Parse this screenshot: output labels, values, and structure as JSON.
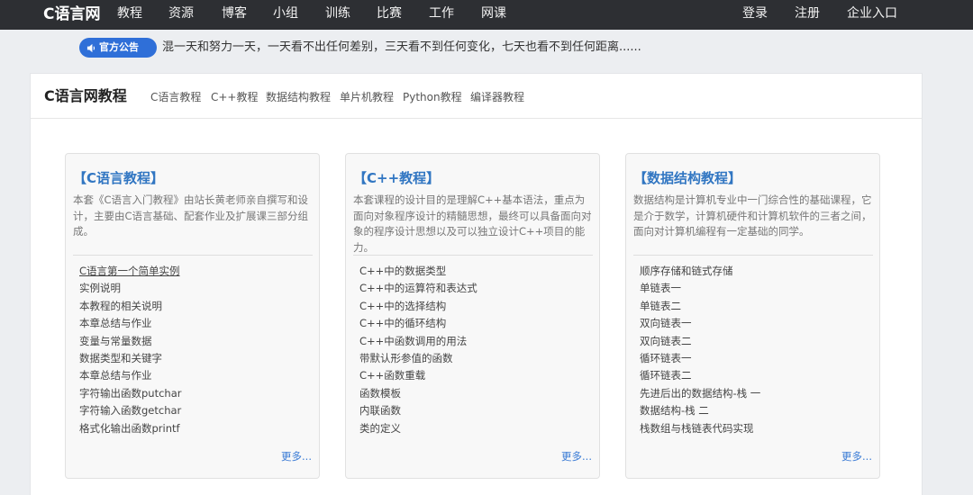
{
  "topnav": {
    "logo": "C语言网",
    "left_items": [
      "教程",
      "资源",
      "博客",
      "小组",
      "训练",
      "比赛",
      "工作",
      "网课"
    ],
    "right_items": [
      "登录",
      "注册",
      "企业入口"
    ],
    "bg_color": "#2d2f33"
  },
  "notice": {
    "badge": "官方公告",
    "text": "混一天和努力一天，一天看不出任何差别，三天看不到任何变化，七天也看不到任何距离......",
    "badge_color": "#2f6fd8"
  },
  "panel": {
    "title": "C语言网教程",
    "tabs": [
      "C语言教程",
      "C++教程",
      "数据结构教程",
      "单片机教程",
      "Python教程",
      "编译器教程"
    ]
  },
  "cards": [
    {
      "title": "【C语言教程】",
      "desc": "本套《C语言入门教程》由站长黄老师亲自撰写和设计，主要由C语言基础、配套作业及扩展课三部分组成。",
      "items": [
        "C语言第一个简单实例",
        "实例说明",
        "本教程的相关说明",
        "本章总结与作业",
        "变量与常量数据",
        "数据类型和关键字",
        "本章总结与作业",
        "字符输出函数putchar",
        "字符输入函数getchar",
        "格式化输出函数printf"
      ],
      "more": "更多..."
    },
    {
      "title": "【C++教程】",
      "desc": "本套课程的设计目的是理解C++基本语法，重点为面向对象程序设计的精髓思想，最终可以具备面向对象的程序设计思想以及可以独立设计C++项目的能力。",
      "items": [
        "C++中的数据类型",
        "C++中的运算符和表达式",
        "C++中的选择结构",
        "C++中的循环结构",
        "C++中函数调用的用法",
        "带默认形参值的函数",
        "C++函数重载",
        "函数模板",
        "内联函数",
        "类的定义"
      ],
      "more": "更多..."
    },
    {
      "title": "【数据结构教程】",
      "desc": "数据结构是计算机专业中一门综合性的基础课程，它是介于数学，计算机硬件和计算机软件的三者之间，面向对计算机编程有一定基础的同学。",
      "items": [
        "顺序存储和链式存储",
        "单链表一",
        "单链表二",
        "双向链表一",
        "双向链表二",
        "循环链表一",
        "循环链表二",
        "先进后出的数据结构-栈 一",
        "数据结构-栈 二",
        "栈数组与栈链表代码实现"
      ],
      "more": "更多..."
    }
  ]
}
